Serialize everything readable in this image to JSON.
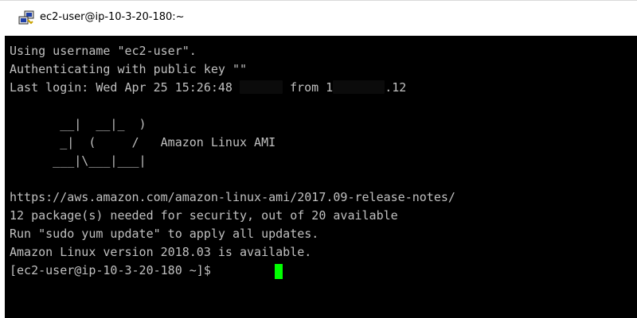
{
  "window": {
    "title": "ec2-user@ip-10-3-20-180:~",
    "icon": "putty-icon"
  },
  "terminal": {
    "lines": [
      "Using username \"ec2-user\".",
      "Authenticating with public key \"\"",
      "Last login: Wed Apr 25 15:26:48 ",
      " from 1",
      ".12",
      "",
      "       __|  __|_  )",
      "       _|  (     /   Amazon Linux AMI",
      "      ___|\\___|___|",
      "",
      "https://aws.amazon.com/amazon-linux-ami/2017.09-release-notes/",
      "12 package(s) needed for security, out of 20 available",
      "Run \"sudo yum update\" to apply all updates.",
      "Amazon Linux version 2018.03 is available.",
      "[ec2-user@ip-10-3-20-180 ~]$ "
    ],
    "colors": {
      "background": "#000000",
      "text": "#c0c0c0",
      "cursor": "#00ff00"
    }
  }
}
